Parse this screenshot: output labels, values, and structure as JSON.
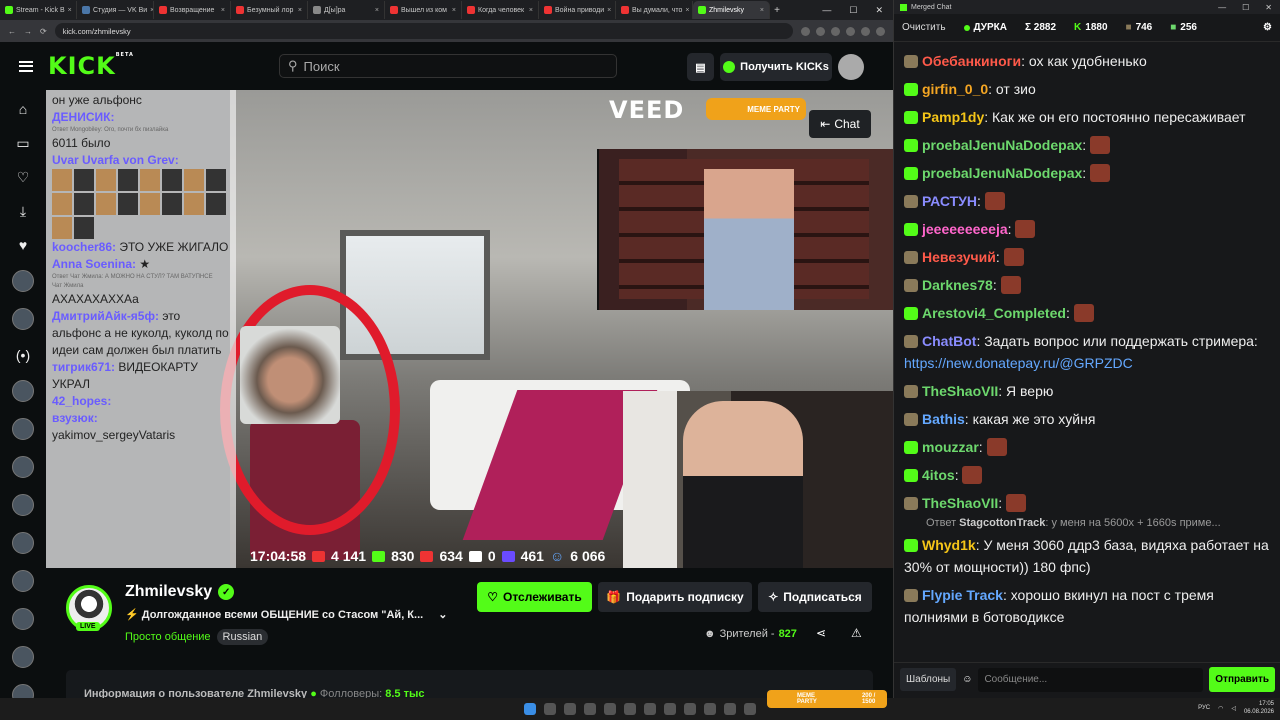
{
  "browser": {
    "tabs": [
      {
        "label": "Stream - Kick B",
        "icon": "kick",
        "active": false
      },
      {
        "label": "Студия — VK Ви",
        "icon": "vk",
        "active": false
      },
      {
        "label": "Возвращение",
        "icon": "yt",
        "active": false
      },
      {
        "label": "Безумный лор",
        "icon": "yt",
        "active": false
      },
      {
        "label": "Д[ы]ра",
        "icon": "doc",
        "active": false
      },
      {
        "label": "Вышел из ком",
        "icon": "yt",
        "active": false
      },
      {
        "label": "Когда человек",
        "icon": "yt",
        "active": false
      },
      {
        "label": "Война приводи",
        "icon": "yt",
        "active": false
      },
      {
        "label": "Вы думали, что",
        "icon": "yt",
        "active": false
      },
      {
        "label": "Zhmilevsky",
        "icon": "kick",
        "active": true
      }
    ],
    "url": "kick.com/zhmilevsky"
  },
  "header": {
    "logo": "KICK",
    "logo_sup": "BETA",
    "search_placeholder": "Поиск",
    "get_kicks": "Получить KICKs"
  },
  "video": {
    "veed": "VEED",
    "meme_party": "MEME PARTY",
    "chat_button": "Chat",
    "overlay_chat": [
      {
        "user": "",
        "text": "он уже альфонс"
      },
      {
        "user": "ДЕНИСИК:",
        "text": ""
      },
      {
        "user": "",
        "text": "Ответ Mongobiley: Ого, почти бх пизлайка",
        "small": true
      },
      {
        "user": "",
        "text": "6011 было"
      },
      {
        "user": "Uvar Uvarfa von Grev:",
        "text": ""
      },
      {
        "user": "koocher86:",
        "text": "ЭТО УЖЕ ЖИГАЛО"
      },
      {
        "user": "Anna Soenina:",
        "text": "★"
      },
      {
        "user": "",
        "text": "Ответ Чат Жмила: А МОЖНО НА СТУЛ? ТАМ ВАТУПНСЕ",
        "small": true
      },
      {
        "user": "",
        "text": "Чат Жмила",
        "small": true
      },
      {
        "user": "",
        "text": "АХАХАХАХХАа"
      },
      {
        "user": "ДмитрийАйк-я5ф:",
        "text": "это альфонс а не куколд, куколд по идеи сам должен был платить"
      },
      {
        "user": "тигрик671:",
        "text": "ВИДЕОКАРТУ УКРАЛ"
      },
      {
        "user": "42_hopes:",
        "text": ""
      },
      {
        "user": "взузюк:",
        "text": ""
      },
      {
        "user": "",
        "text": "yakimov_sergeyVataris"
      }
    ],
    "status": {
      "time": "17:04:58",
      "youtube": "4 141",
      "kick": "830",
      "vk": "634",
      "rutube": "0",
      "twitch": "461",
      "total": "6 066"
    }
  },
  "channel": {
    "name": "Zhmilevsky",
    "live": "LIVE",
    "title": "Долгожданное всеми ОБЩЕНИЕ со Стасом \"Ай, К...",
    "category": "Просто общение",
    "language": "Russian",
    "follow": "Отслеживать",
    "gift": "Подарить подписку",
    "subscribe": "Подписаться",
    "viewers_label": "Зрителей -",
    "viewers_count": "827",
    "about_prefix": "Информация о пользователе Zhmilevsky",
    "followers_label": "Фолловеры:",
    "followers_count": "8.5 тыс"
  },
  "chat_window": {
    "title": "Merged Chat",
    "clear": "Очистить",
    "status_name": "ДУРКА",
    "sum": "Σ 2882",
    "kick_count": "1880",
    "badge2_count": "746",
    "badge3_count": "256",
    "messages": [
      {
        "badge": "p",
        "user": "Обебанкиноги",
        "color": "#ff5a4a",
        "text": "ох как удобненько",
        "emote": false
      },
      {
        "badge": "k",
        "user": "girfin_0_0",
        "color": "#f5a623",
        "text": "от зио",
        "emote": false
      },
      {
        "badge": "k",
        "user": "Pamp1dy",
        "color": "#f5c518",
        "text": "Как же он его постоянно пересаживает",
        "emote": false
      },
      {
        "badge": "k",
        "user": "proebalJenuNaDodepax",
        "color": "#6dd86d",
        "text": "",
        "emote": true
      },
      {
        "badge": "k",
        "user": "proebalJenuNaDodepax",
        "color": "#6dd86d",
        "text": "",
        "emote": true
      },
      {
        "badge": "p",
        "user": "РАСТУН",
        "color": "#8a8cff",
        "text": "",
        "emote": true
      },
      {
        "badge": "k",
        "user": "jeeeeeeeeeja",
        "color": "#ff66cc",
        "text": "",
        "emote": true
      },
      {
        "badge": "p",
        "user": "Невезучий",
        "color": "#ff5a4a",
        "text": "",
        "emote": true
      },
      {
        "badge": "p",
        "user": "Darknes78",
        "color": "#6dd86d",
        "text": "",
        "emote": true
      },
      {
        "badge": "k",
        "user": "Arestovi4_Completed",
        "color": "#6dd86d",
        "text": "",
        "emote": true
      },
      {
        "badge": "p",
        "user": "ChatBot",
        "color": "#8a8cff",
        "text": "Задать вопрос или поддержать стримера: ",
        "link": "https://new.donatepay.ru/@GRPZDC",
        "emote": false
      },
      {
        "badge": "p",
        "user": "TheShaoVII",
        "color": "#6dd86d",
        "text": "Я верю",
        "emote": false
      },
      {
        "badge": "p",
        "user": "Bathis",
        "color": "#64a8ff",
        "text": "какая же это хуйня",
        "emote": false
      },
      {
        "badge": "k",
        "user": "mouzzar",
        "color": "#6dd86d",
        "text": "",
        "emote": true
      },
      {
        "badge": "k",
        "user": "4itos",
        "color": "#6dd86d",
        "text": "",
        "emote": true
      },
      {
        "badge": "p",
        "user": "TheShaoVII",
        "color": "#6dd86d",
        "text": "",
        "emote": true
      }
    ],
    "reply": {
      "prefix": "Ответ",
      "user": "StagcottonTrack",
      "text": ": у меня на 5600x + 1660s приме..."
    },
    "messages2": [
      {
        "badge": "k",
        "user": "Whyd1k",
        "color": "#f5c518",
        "text": "У меня 3060 ддр3 база, видяха работает на 30% от мощности)) 180 фпс)"
      },
      {
        "badge": "p",
        "user": "Flypie Track",
        "color": "#64a8ff",
        "text": "хорошо вкинул на пост с тремя полниями в ботоводиксе"
      }
    ],
    "templates": "Шаблоны",
    "input_placeholder": "Сообщение...",
    "send": "Отправить"
  },
  "taskbar": {
    "meme_party": "MEME PARTY",
    "meme_progress": "200 / 1500",
    "lang": "РУС",
    "time": "17:05",
    "date": "06.08.2026"
  }
}
